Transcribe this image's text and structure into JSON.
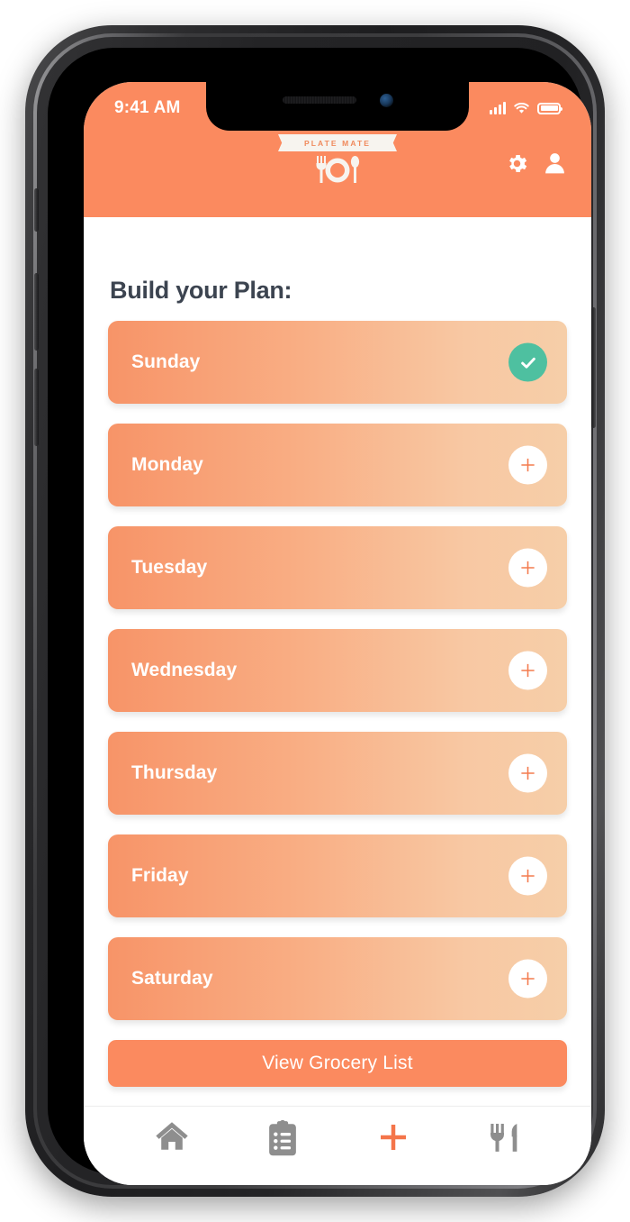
{
  "status_bar": {
    "time": "9:41 AM",
    "signal_icon": "cellular-signal-icon",
    "wifi_icon": "wifi-icon",
    "battery_icon": "battery-icon"
  },
  "header": {
    "logo_text": "PLATE MATE",
    "logo_icon": "fork-plate-spoon-icon",
    "settings_icon": "gear-icon",
    "profile_icon": "person-icon",
    "background_color": "#FB8A5F"
  },
  "main": {
    "title": "Build your Plan:",
    "title_color": "#3C4450",
    "days": [
      {
        "label": "Sunday",
        "action": "check",
        "action_icon": "check-icon",
        "action_color": "#4EC0A0"
      },
      {
        "label": "Monday",
        "action": "add",
        "action_icon": "plus-icon",
        "action_color": "#F47B4E"
      },
      {
        "label": "Tuesday",
        "action": "add",
        "action_icon": "plus-icon",
        "action_color": "#F47B4E"
      },
      {
        "label": "Wednesday",
        "action": "add",
        "action_icon": "plus-icon",
        "action_color": "#F47B4E"
      },
      {
        "label": "Thursday",
        "action": "add",
        "action_icon": "plus-icon",
        "action_color": "#F47B4E"
      },
      {
        "label": "Friday",
        "action": "add",
        "action_icon": "plus-icon",
        "action_color": "#F47B4E"
      },
      {
        "label": "Saturday",
        "action": "add",
        "action_icon": "plus-icon",
        "action_color": "#F47B4E"
      }
    ],
    "grocery_button_label": "View Grocery List",
    "row_gradient_start": "#F79468",
    "row_gradient_end": "#F6CEA8"
  },
  "bottom_nav": {
    "items": [
      {
        "name": "home",
        "icon": "home-icon",
        "color": "#8E8E8E"
      },
      {
        "name": "lists",
        "icon": "clipboard-icon",
        "color": "#8E8E8E"
      },
      {
        "name": "add",
        "icon": "plus-icon",
        "color": "#F4754A"
      },
      {
        "name": "recipes",
        "icon": "fork-knife-icon",
        "color": "#8E8E8E"
      }
    ]
  }
}
